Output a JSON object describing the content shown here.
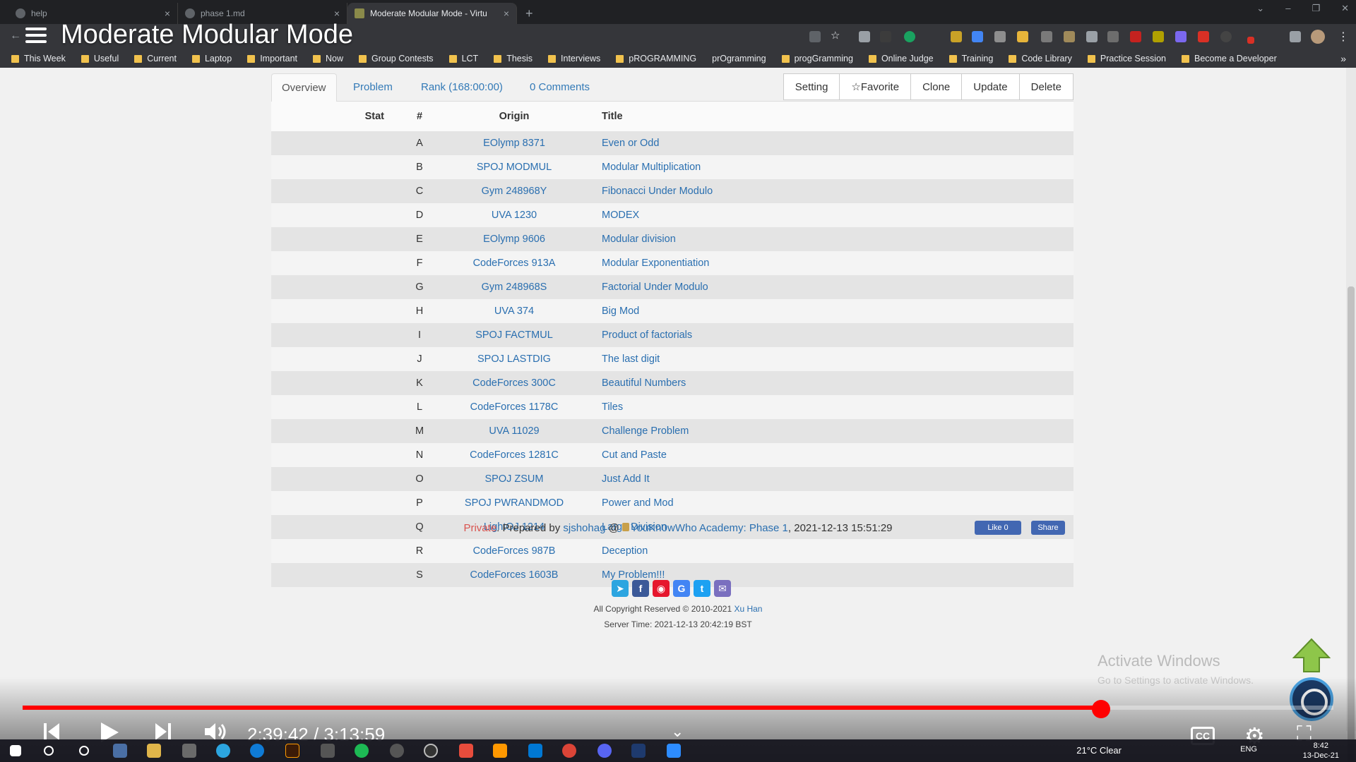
{
  "browser": {
    "tabs": [
      {
        "label": "help",
        "active": false
      },
      {
        "label": "phase 1.md",
        "active": false
      },
      {
        "label": "Moderate Modular Mode - Virtu",
        "active": true
      }
    ],
    "new_tab": "+",
    "bookmarks": [
      "This Week",
      "Useful",
      "Current",
      "Laptop",
      "Important",
      "Now",
      "Group Contests",
      "LCT",
      "Thesis",
      "Interviews",
      "pROGRAMMING",
      "prOgramming",
      "progGramming",
      "Online Judge",
      "Training",
      "Code Library",
      "Practice Session",
      "Become a Developer"
    ],
    "bookmarks_more": "»"
  },
  "video": {
    "title": "Moderate Modular Mode",
    "time": "2:39:42 / 3:13:59",
    "progress": 0.823,
    "cc_label": "CC"
  },
  "contest": {
    "nav": {
      "overview": "Overview",
      "problem": "Problem",
      "rank": "Rank (168:00:00)",
      "comments": "0 Comments"
    },
    "actions": {
      "setting": "Setting",
      "favorite": "☆Favorite",
      "clone": "Clone",
      "update": "Update",
      "delete": "Delete"
    },
    "columns": {
      "stat": "Stat",
      "num": "#",
      "origin": "Origin",
      "title": "Title"
    },
    "problems": [
      {
        "num": "A",
        "origin": "EOlymp 8371",
        "title": "Even or Odd"
      },
      {
        "num": "B",
        "origin": "SPOJ MODMUL",
        "title": "Modular Multiplication"
      },
      {
        "num": "C",
        "origin": "Gym 248968Y",
        "title": "Fibonacci Under Modulo"
      },
      {
        "num": "D",
        "origin": "UVA 1230",
        "title": "MODEX"
      },
      {
        "num": "E",
        "origin": "EOlymp 9606",
        "title": "Modular division"
      },
      {
        "num": "F",
        "origin": "CodeForces 913A",
        "title": "Modular Exponentiation"
      },
      {
        "num": "G",
        "origin": "Gym 248968S",
        "title": "Factorial Under Modulo"
      },
      {
        "num": "H",
        "origin": "UVA 374",
        "title": "Big Mod"
      },
      {
        "num": "I",
        "origin": "SPOJ FACTMUL",
        "title": "Product of factorials"
      },
      {
        "num": "J",
        "origin": "SPOJ LASTDIG",
        "title": "The last digit"
      },
      {
        "num": "K",
        "origin": "CodeForces 300C",
        "title": "Beautiful Numbers"
      },
      {
        "num": "L",
        "origin": "CodeForces 1178C",
        "title": "Tiles"
      },
      {
        "num": "M",
        "origin": "UVA 11029",
        "title": "Challenge Problem"
      },
      {
        "num": "N",
        "origin": "CodeForces 1281C",
        "title": "Cut and Paste"
      },
      {
        "num": "O",
        "origin": "SPOJ ZSUM",
        "title": "Just Add It"
      },
      {
        "num": "P",
        "origin": "SPOJ PWRANDMOD",
        "title": "Power and Mod"
      },
      {
        "num": "Q",
        "origin": "LightOJ 1214",
        "title": "Large Division"
      },
      {
        "num": "R",
        "origin": "CodeForces 987B",
        "title": "Deception"
      },
      {
        "num": "S",
        "origin": "CodeForces 1603B",
        "title": "My Problem!!!"
      }
    ],
    "footer": {
      "private": "Private",
      "prepared_by": ". Prepared by ",
      "author": "sjshohag",
      "at": " @ ",
      "group": "YouKn0wWho Academy: Phase 1",
      "date": ", 2021-12-13 15:51:29",
      "like": "Like 0",
      "share": "Share"
    }
  },
  "site_footer": {
    "copyright": "All Copyright Reserved © 2010-2021 ",
    "copyright_owner": "Xu Han",
    "server_time": "Server Time: 2021-12-13 20:42:19 BST"
  },
  "watermark": {
    "line1": "Activate Windows",
    "line2": "Go to Settings to activate Windows."
  },
  "taskbar": {
    "weather": "21°C  Clear",
    "time": "8:42",
    "date": "13-Dec-21",
    "lang": "ENG"
  },
  "colors": {
    "accent_red": "#ff0000",
    "link_blue": "#2a6fb0",
    "private_red": "#d9534f"
  }
}
